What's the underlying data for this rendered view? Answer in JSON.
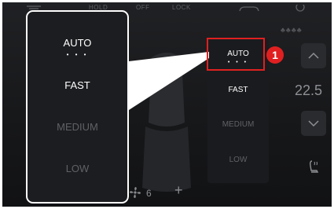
{
  "top_bar": {
    "hold": "HOLD",
    "off": "OFF",
    "lock": "LOCK"
  },
  "zoom_menu": {
    "options": [
      {
        "label": "AUTO",
        "dots": "• • •"
      },
      {
        "label": "FAST"
      },
      {
        "label": "MEDIUM"
      },
      {
        "label": "LOW"
      }
    ]
  },
  "fan_menu": {
    "options": [
      {
        "label": "AUTO",
        "dots": "• • •"
      },
      {
        "label": "FAST"
      },
      {
        "label": "MEDIUM"
      },
      {
        "label": "LOW"
      }
    ],
    "selected": "AUTO"
  },
  "callout_badge": "1",
  "fan_speed": "6",
  "temperature": "22.5",
  "colors": {
    "highlight": "#e02020",
    "active_text": "#ffffff",
    "inactive_text": "#5f6165"
  },
  "icons": [
    "fan-icon",
    "plus-icon",
    "chevron-up-icon",
    "chevron-down-icon",
    "seat-heat-icon",
    "seat-occupancy-icon",
    "car-icon",
    "steering-heat-icon"
  ]
}
